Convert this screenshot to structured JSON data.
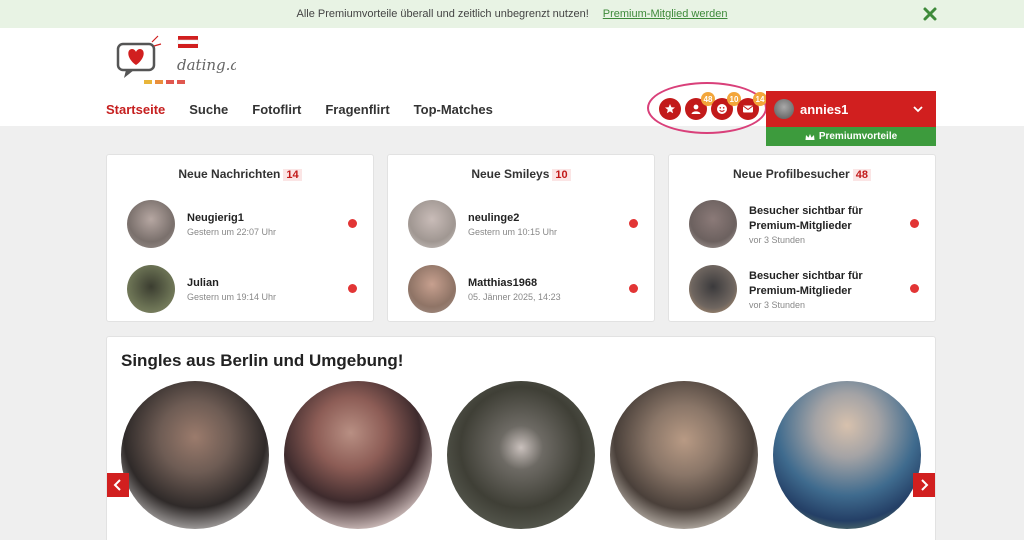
{
  "promo": {
    "text": "Alle Premiumvorteile überall und zeitlich unbegrenzt nutzen!",
    "link": "Premium-Mitglied werden"
  },
  "logo": {
    "text": "dating.at"
  },
  "nav": [
    {
      "label": "Startseite",
      "active": true
    },
    {
      "label": "Suche"
    },
    {
      "label": "Fotoflirt"
    },
    {
      "label": "Fragenflirt"
    },
    {
      "label": "Top-Matches"
    }
  ],
  "quick": {
    "visitors_badge": "48",
    "smileys_badge": "10",
    "messages_badge": "14"
  },
  "user": {
    "name": "annies1",
    "premium_label": "Premiumvorteile"
  },
  "cards": [
    {
      "title": "Neue Nachrichten",
      "count": "14",
      "items": [
        {
          "name": "Neugierig1",
          "sub": "Gestern um 22:07 Uhr"
        },
        {
          "name": "Julian",
          "sub": "Gestern um 19:14 Uhr"
        }
      ]
    },
    {
      "title": "Neue Smileys",
      "count": "10",
      "items": [
        {
          "name": "neulinge2",
          "sub": "Gestern um 10:15 Uhr"
        },
        {
          "name": "Matthias1968",
          "sub": "05. Jänner 2025, 14:23"
        }
      ]
    },
    {
      "title": "Neue Profilbesucher",
      "count": "48",
      "items": [
        {
          "name": "Besucher sichtbar für Premium-Mitglieder",
          "sub": "vor 3 Stunden"
        },
        {
          "name": "Besucher sichtbar für Premium-Mitglieder",
          "sub": "vor 3 Stunden"
        }
      ]
    }
  ],
  "singles": {
    "title": "Singles aus Berlin und Umgebung!"
  },
  "colors": {
    "accent": "#d11f1f",
    "green": "#3d9b3d",
    "badge": "#f3a63b"
  }
}
